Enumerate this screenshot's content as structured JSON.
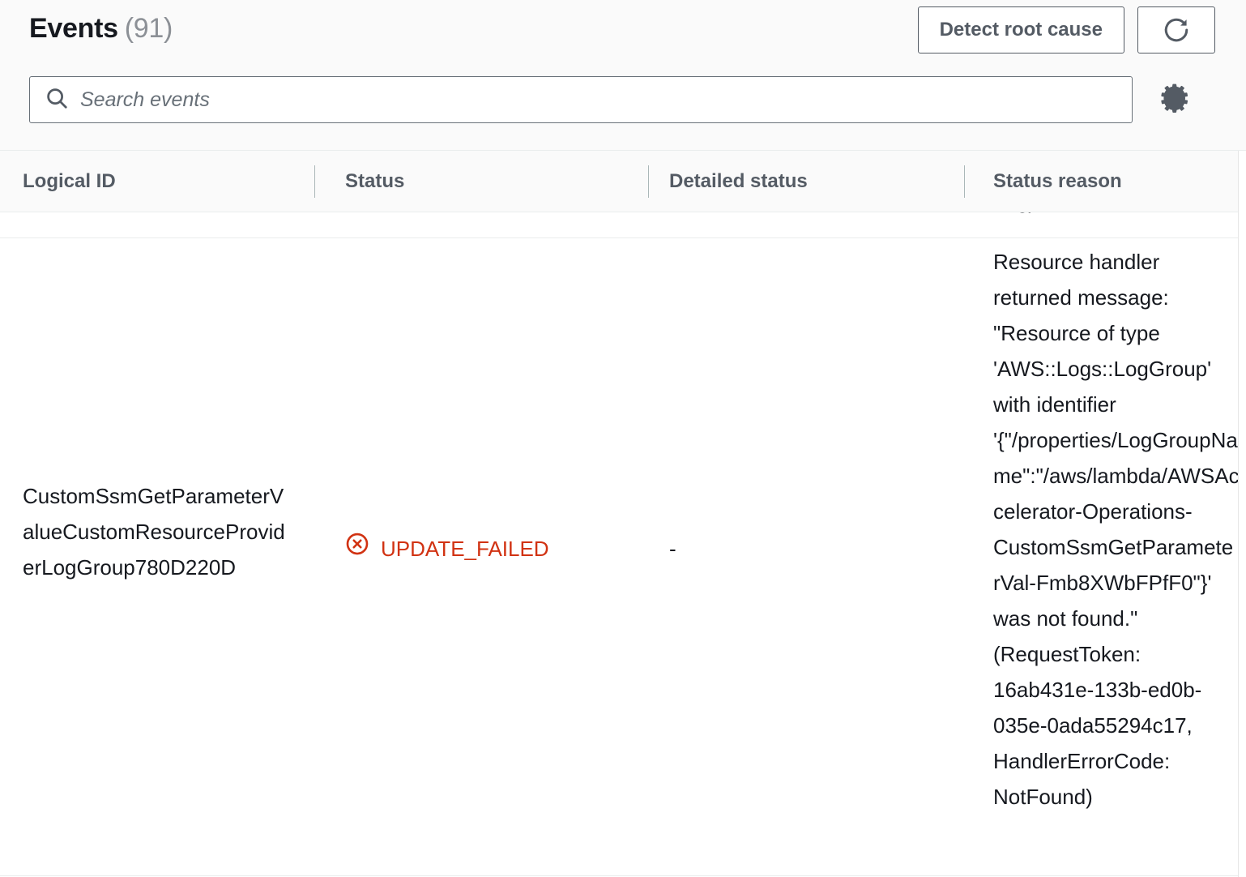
{
  "header": {
    "title": "Events",
    "count": "(91)",
    "detect_root_cause_label": "Detect root cause",
    "refresh_icon": "refresh-icon"
  },
  "search": {
    "placeholder": "Search events",
    "value": "",
    "search_icon": "search-icon",
    "settings_icon": "gear-icon"
  },
  "table": {
    "columns": [
      {
        "key": "logical_id",
        "label": "Logical ID"
      },
      {
        "key": "status",
        "label": "Status"
      },
      {
        "key": "detailed_status",
        "label": "Detailed status"
      },
      {
        "key": "status_reason",
        "label": "Status reason"
      }
    ],
    "clipped_previous_row_text": "Log)",
    "rows": [
      {
        "logical_id": "CustomSsmGetParameterValueCustomResourceProviderLogGroup780D220D",
        "status": "UPDATE_FAILED",
        "status_icon": "error-circle-x-icon",
        "status_color": "#d13212",
        "detailed_status": "-",
        "status_reason": "Resource handler returned message: \"Resource of type 'AWS::Logs::LogGroup' with identifier '{\"/properties/LogGroupName\":\"/aws/lambda/AWSAccelerator-Operations-CustomSsmGetParameterVal-Fmb8XWbFPfF0\"}' was not found.\" (RequestToken: 16ab431e-133b-ed0b-035e-0ada55294c17, HandlerErrorCode: NotFound)"
      }
    ]
  },
  "colors": {
    "error": "#d13212",
    "header_bg": "#fafafa",
    "border": "#eaeded",
    "muted_text": "#545b64",
    "placeholder": "#687078"
  }
}
